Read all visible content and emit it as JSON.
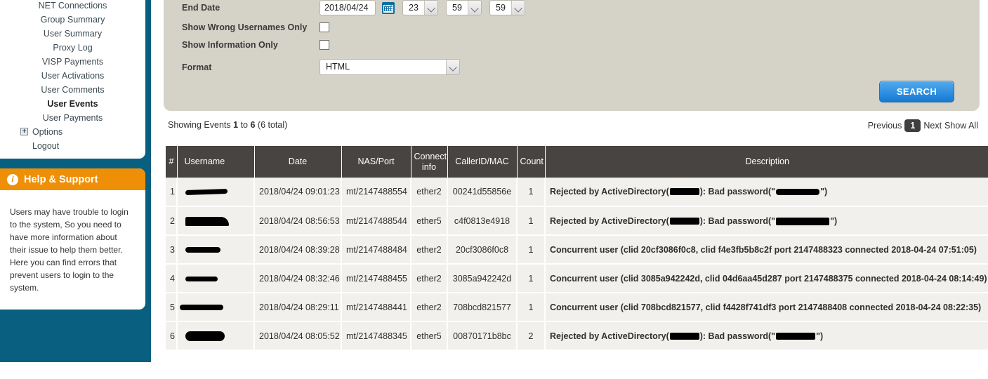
{
  "sidebar": {
    "nav_items": [
      {
        "label": "NET Connections",
        "bold": false,
        "indent": false
      },
      {
        "label": "Group Summary",
        "bold": false,
        "indent": false
      },
      {
        "label": "User Summary",
        "bold": false,
        "indent": false
      },
      {
        "label": "Proxy Log",
        "bold": false,
        "indent": false
      },
      {
        "label": "VISP Payments",
        "bold": false,
        "indent": false
      },
      {
        "label": "User Activations",
        "bold": false,
        "indent": false
      },
      {
        "label": "User Comments",
        "bold": false,
        "indent": false
      },
      {
        "label": "User Events",
        "bold": true,
        "indent": false
      },
      {
        "label": "User Payments",
        "bold": false,
        "indent": false
      }
    ],
    "options_label": "Options",
    "options_expand_glyph": "+",
    "logout_label": "Logout",
    "help": {
      "icon": "info-icon",
      "title": "Help & Support",
      "body": "Users may have trouble to login to the system, So you need to have more information about their issue to help them better. Here you can find errors that prevent users to login to the system."
    }
  },
  "form": {
    "end_date": {
      "label": "End Date",
      "value": "2018/04/24",
      "calendar_icon": "calendar-icon",
      "hour": "23",
      "minute": "59",
      "second": "59"
    },
    "wrong_usernames": {
      "label": "Show Wrong Usernames Only",
      "checked": false
    },
    "information_only": {
      "label": "Show Information Only",
      "checked": false
    },
    "format": {
      "label": "Format",
      "value": "HTML"
    },
    "search_label": "SEARCH"
  },
  "results": {
    "showing_prefix": "Showing Events",
    "showing_from": "1",
    "showing_to_word": "to",
    "showing_to": "6",
    "showing_total": "(6 total)",
    "pager": {
      "previous": "Previous",
      "current_page": "1",
      "next": "Next",
      "show_all": "Show All"
    },
    "columns": [
      "#",
      "Username",
      "Date",
      "NAS/Port",
      "Connect info",
      "CallerID/MAC",
      "Count",
      "Description"
    ],
    "rows": [
      {
        "num": "1",
        "username": "[redacted]",
        "date": "2018/04/24 09:01:23",
        "nas_port": "mt/2147488554",
        "connect_info": "ether2",
        "caller_id": "00241d55856e",
        "count": "1",
        "desc_prefix": "Rejected by ActiveDirectory(",
        "desc_mid": "): Bad password(\"",
        "desc_suffix": "\")"
      },
      {
        "num": "2",
        "username": "[redacted]",
        "date": "2018/04/24 08:56:53",
        "nas_port": "mt/2147488544",
        "connect_info": "ether5",
        "caller_id": "c4f0813e4918",
        "count": "1",
        "desc_prefix": "Rejected by ActiveDirectory(",
        "desc_mid": "): Bad password(\"",
        "desc_suffix": "\")"
      },
      {
        "num": "3",
        "username": "[redacted]",
        "date": "2018/04/24 08:39:28",
        "nas_port": "mt/2147488484",
        "connect_info": "ether2",
        "caller_id": "20cf3086f0c8",
        "count": "1",
        "description": "Concurrent user (clid 20cf3086f0c8, clid f4e3fb5b8c2f port 2147488323 connected 2018-04-24 07:51:05)"
      },
      {
        "num": "4",
        "username": "[redacted]",
        "date": "2018/04/24 08:32:46",
        "nas_port": "mt/2147488455",
        "connect_info": "ether2",
        "caller_id": "3085a942242d",
        "count": "1",
        "description": "Concurrent user (clid 3085a942242d, clid 04d6aa45d287 port 2147488375 connected 2018-04-24 08:14:49)"
      },
      {
        "num": "5",
        "username": "[redacted]",
        "date": "2018/04/24 08:29:11",
        "nas_port": "mt/2147488441",
        "connect_info": "ether2",
        "caller_id": "708bcd821577",
        "count": "1",
        "description": "Concurrent user (clid 708bcd821577, clid f4428f741df3 port 2147488408 connected 2018-04-24 08:22:35)"
      },
      {
        "num": "6",
        "username": "[redacted]",
        "date": "2018/04/24 08:05:52",
        "nas_port": "mt/2147488345",
        "connect_info": "ether5",
        "caller_id": "00870171b8bc",
        "count": "2",
        "desc_prefix": "Rejected by ActiveDirectory(",
        "desc_mid": "): Bad password(\"",
        "desc_suffix": "\")"
      }
    ]
  },
  "colors": {
    "sidebar_teal": "#095f80",
    "help_orange": "#ef8f08",
    "form_panel": "#d5d2c8",
    "table_header": "#474442",
    "row_bg": "#f1f0ec",
    "search_blue": "#1479d4"
  }
}
